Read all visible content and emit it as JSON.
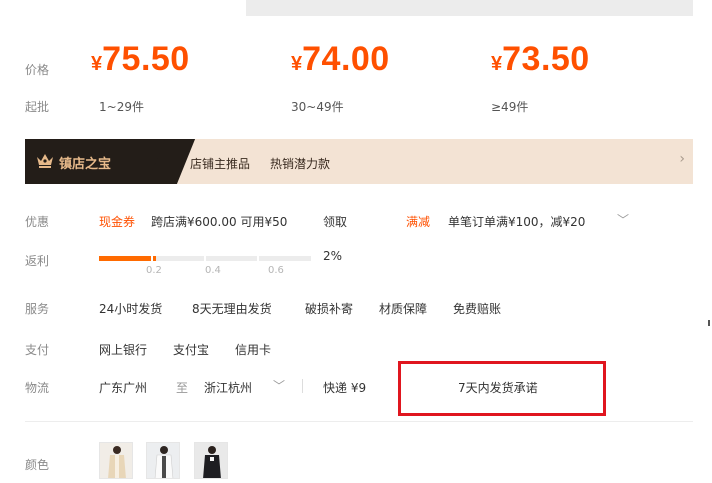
{
  "tabs": [
    "",
    "",
    ""
  ],
  "labels": {
    "price": "价格",
    "min_order": "起批",
    "discount": "优惠",
    "rebate": "返利",
    "service": "服务",
    "payment": "支付",
    "logistics": "物流",
    "color": "颜色"
  },
  "prices": [
    {
      "symbol": "¥",
      "value": "75.50",
      "range": "1~29件"
    },
    {
      "symbol": "¥",
      "value": "74.00",
      "range": "30~49件"
    },
    {
      "symbol": "¥",
      "value": "73.50",
      "range": "≥49件"
    }
  ],
  "banner": {
    "title": "镇店之宝",
    "tag1": "店铺主推品",
    "tag2": "热销潜力款",
    "chevron": "›"
  },
  "discount": {
    "coupon_label": "现金券",
    "coupon_text": "跨店满¥600.00 可用¥50",
    "claim": "领取",
    "promo_label": "满减",
    "promo_text": "单笔订单满¥100，减¥20",
    "expand": "﹀"
  },
  "rebate": {
    "progress": 0.27,
    "ticks": [
      "0.2",
      "0.4",
      "0.6"
    ],
    "percent": "2%"
  },
  "services": [
    "24小时发货",
    "8天无理由发货",
    "破损补寄",
    "材质保障",
    "免费赔账"
  ],
  "payments": [
    "网上银行",
    "支付宝",
    "信用卡"
  ],
  "logistics": {
    "from": "广东广州",
    "to_word": "至",
    "to": "浙江杭州",
    "dropdown": "﹀",
    "express": "快递 ¥9",
    "promise": "7天内发货承诺"
  },
  "colors": {
    "accent": "#ff5000",
    "highlight_box": "#e0161f",
    "banner_bg": "#f3e3d4",
    "banner_dark": "#231d18"
  },
  "swatch_icons": [
    "beige-outfit-thumbnail",
    "white-outfit-thumbnail",
    "black-outfit-thumbnail"
  ]
}
